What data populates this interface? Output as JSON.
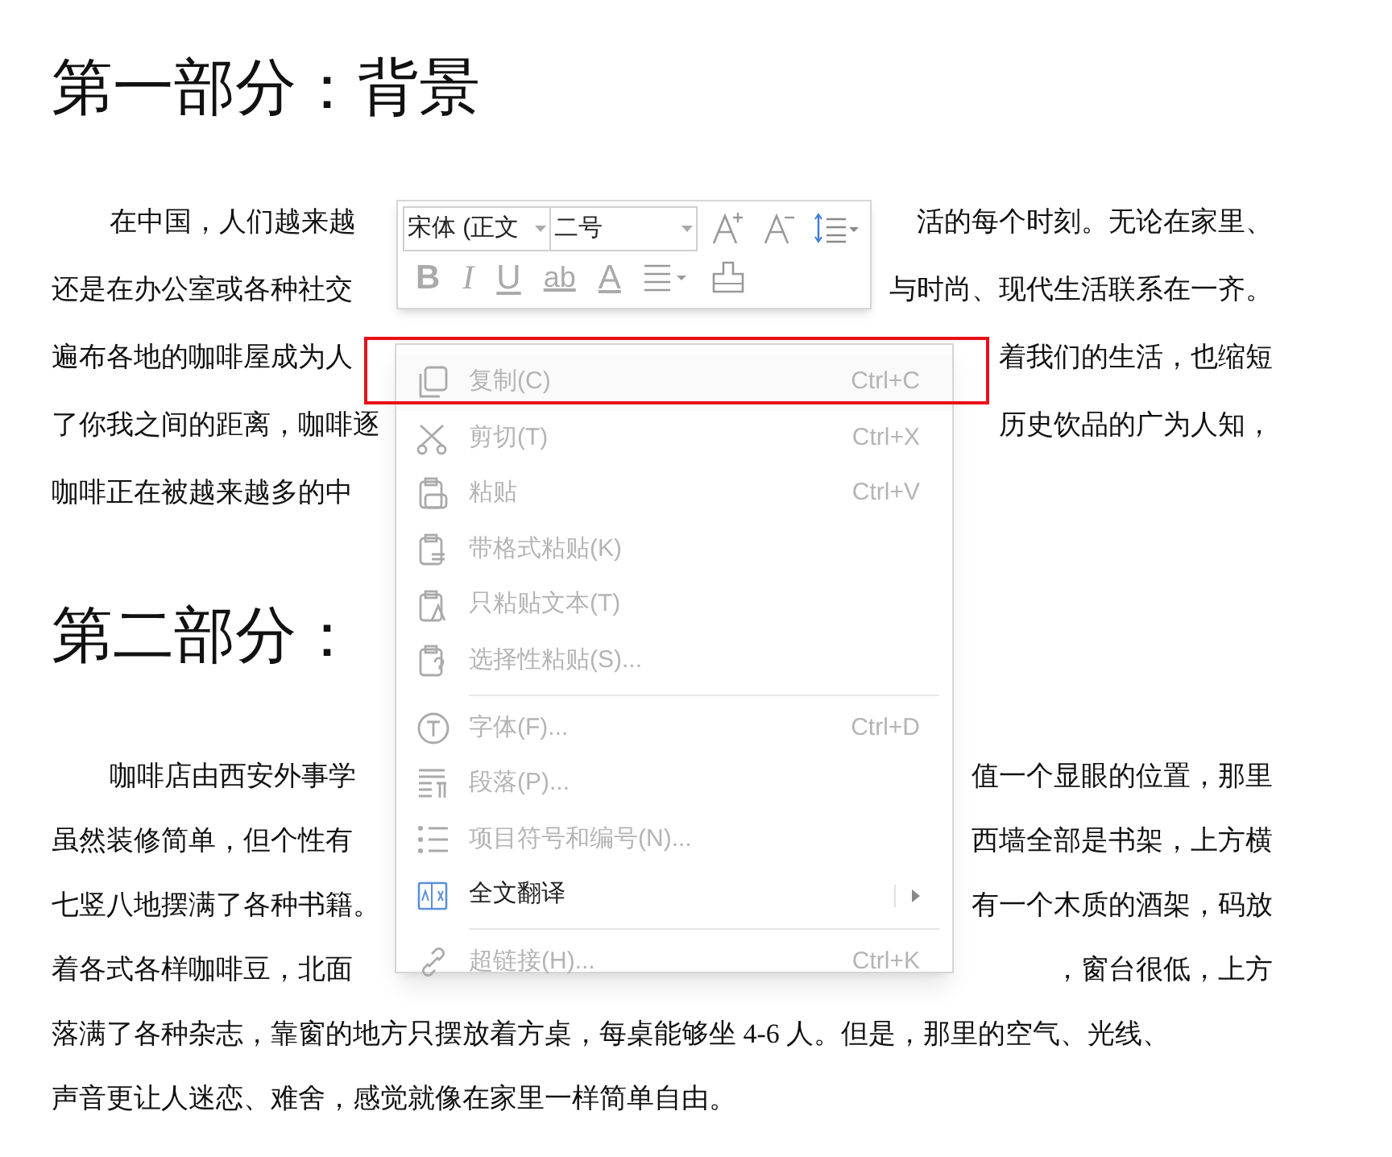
{
  "document": {
    "heading_1": "第一部分：背景",
    "paragraph_1": [
      {
        "left": "在中国，人们越来越",
        "right": "活的每个时刻。无论在家里、"
      },
      {
        "left": "还是在办公室或各种社交",
        "right": "与时尚、现代生活联系在一齐。"
      },
      {
        "left": "遍布各地的咖啡屋成为人",
        "right": "着我们的生活，也缩短"
      },
      {
        "left": "了你我之间的距离，咖啡逐",
        "right": "历史饮品的广为人知，"
      },
      {
        "left": "咖啡正在被越来越多的中"
      }
    ],
    "heading_2": "第二部分：",
    "paragraph_2": [
      {
        "left": "咖啡店由西安外事学",
        "right": "值一个显眼的位置，那里"
      },
      {
        "left": "虽然装修简单，但个性有",
        "right": "西墙全部是书架，上方横"
      },
      {
        "left": "七竖八地摆满了各种书籍。",
        "right": "有一个木质的酒架，码放"
      },
      {
        "left": "着各式各样咖啡豆，北面",
        "right": "，窗台很低，上方"
      },
      {
        "left": "落满了各种杂志，靠窗的地方只摆放着方桌，每桌能够坐 4-6 人。但是，那里的空气、光线、"
      },
      {
        "left": "声音更让人迷恋、难舍，感觉就像在家里一样简单自由。"
      }
    ]
  },
  "mini_toolbar": {
    "font": "宋体 (正文",
    "size": "二号",
    "bold": "B",
    "italic": "I",
    "underline": "U",
    "highlight": "ab",
    "font_color": "A"
  },
  "context_menu": {
    "items": [
      {
        "label": "复制(C)",
        "shortcut": "Ctrl+C",
        "disabled": true,
        "highlighted": true
      },
      {
        "label": "剪切(T)",
        "shortcut": "Ctrl+X",
        "disabled": true
      },
      {
        "label": "粘贴",
        "shortcut": "Ctrl+V",
        "disabled": true
      },
      {
        "label": "带格式粘贴(K)",
        "disabled": true
      },
      {
        "label": "只粘贴文本(T)",
        "disabled": true
      },
      {
        "label": "选择性粘贴(S)...",
        "disabled": true
      },
      {
        "label": "字体(F)...",
        "shortcut": "Ctrl+D",
        "disabled": true,
        "separator_before": true
      },
      {
        "label": "段落(P)...",
        "disabled": true
      },
      {
        "label": "项目符号和编号(N)...",
        "disabled": true
      },
      {
        "label": "全文翻译",
        "disabled": false,
        "submenu": true
      },
      {
        "label": "超链接(H)...",
        "shortcut": "Ctrl+K",
        "disabled": true,
        "separator_before": true
      }
    ]
  }
}
